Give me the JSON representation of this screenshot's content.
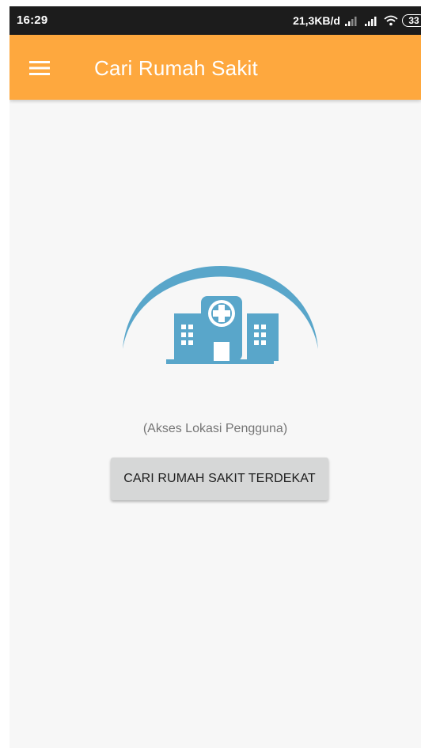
{
  "status_bar": {
    "time": "16:29",
    "network_speed": "21,3KB/d",
    "battery_level": "33",
    "icons": [
      "signal-icon",
      "signal-icon",
      "wifi-icon",
      "battery-icon"
    ]
  },
  "app_bar": {
    "title": "Cari Rumah Sakit",
    "menu_icon": "menu-icon",
    "color": "#fea83e"
  },
  "main": {
    "illustration_icon": "hospital-icon",
    "illustration_color": "#59a6ca",
    "location_status": "(Akses Lokasi Pengguna)",
    "find_button_label": "CARI RUMAH SAKIT TERDEKAT"
  }
}
